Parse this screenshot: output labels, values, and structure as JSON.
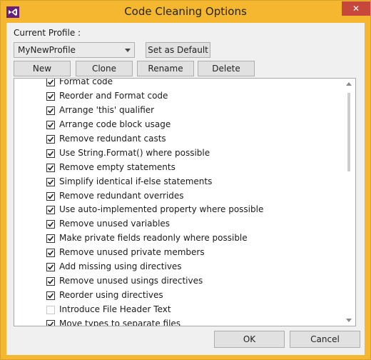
{
  "window": {
    "title": "Code Cleaning Options",
    "close_glyph": "✕",
    "accent_color": "#f5b730",
    "app_icon": "visual-studio-icon"
  },
  "profile": {
    "label": "Current Profile :",
    "selected": "MyNewProfile",
    "set_default_label": "Set as Default"
  },
  "actions": {
    "new_label": "New",
    "clone_label": "Clone",
    "rename_label": "Rename",
    "delete_label": "Delete"
  },
  "options": [
    {
      "label": "Format code",
      "checked": true
    },
    {
      "label": "Reorder and Format code",
      "checked": true
    },
    {
      "label": "Arrange 'this' qualifier",
      "checked": true
    },
    {
      "label": "Arrange code block usage",
      "checked": true
    },
    {
      "label": "Remove redundant casts",
      "checked": true
    },
    {
      "label": "Use String.Format() where possible",
      "checked": true
    },
    {
      "label": "Remove empty statements",
      "checked": true
    },
    {
      "label": "Simplify identical if-else statements",
      "checked": true
    },
    {
      "label": "Remove redundant overrides",
      "checked": true
    },
    {
      "label": "Use auto-implemented property where possible",
      "checked": true
    },
    {
      "label": "Remove unused variables",
      "checked": true
    },
    {
      "label": "Make private fields readonly where possible",
      "checked": true
    },
    {
      "label": "Remove unused private members",
      "checked": true
    },
    {
      "label": "Add missing using directives",
      "checked": true
    },
    {
      "label": "Remove unused usings directives",
      "checked": true
    },
    {
      "label": "Reorder using directives",
      "checked": true
    },
    {
      "label": "Introduce File Header Text",
      "checked": false
    },
    {
      "label": "Move types to separate files",
      "checked": true
    }
  ],
  "footer": {
    "ok_label": "OK",
    "cancel_label": "Cancel"
  }
}
